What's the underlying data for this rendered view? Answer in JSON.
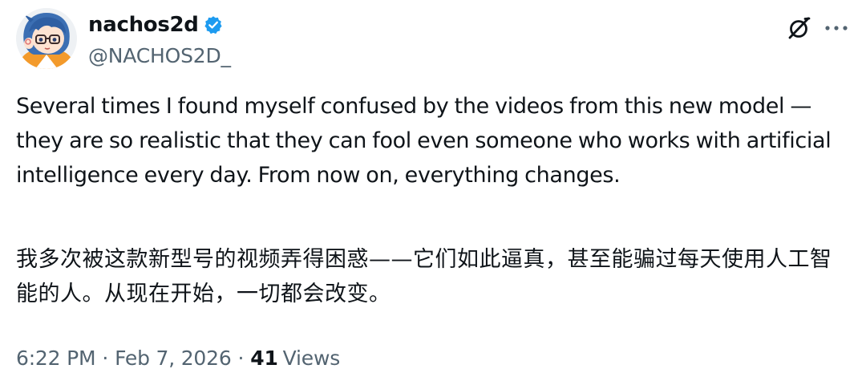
{
  "author": {
    "display_name": "nachos2d",
    "handle": "@NACHOS2D_",
    "verified": true,
    "avatar_icon": "anime-girl-avatar",
    "verified_color": "#1d9bf0"
  },
  "header_actions": {
    "grok_icon": "grok-icon",
    "more_icon": "more-horizontal-icon"
  },
  "tweet": {
    "text_en": "Several times I found myself confused by the videos from this new model — they are so realistic that they can fool even someone who works with artificial intelligence every day. From now on, everything changes.",
    "text_zh": "我多次被这款新型号的视频弄得困惑——它们如此逼真，甚至能骗过每天使用人工智能的人。从现在开始，一切都会改变。"
  },
  "meta": {
    "time": "6:22 PM",
    "separator": "·",
    "date": "Feb 7, 2026",
    "views_count": "41",
    "views_label": "Views"
  },
  "colors": {
    "text_primary": "#0f1419",
    "text_secondary": "#536471"
  }
}
